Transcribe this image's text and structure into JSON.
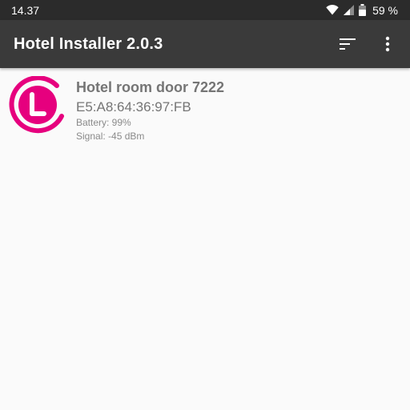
{
  "status_bar": {
    "time": "14.37",
    "battery": "59 %",
    "icons": [
      "wifi-icon",
      "cell-signal-icon",
      "battery-icon"
    ]
  },
  "app_bar": {
    "title": "Hotel Installer 2.0.3",
    "actions": [
      "sort-icon",
      "overflow-menu-icon"
    ]
  },
  "devices": [
    {
      "name": "Hotel room door 7222",
      "mac": "E5:A8:64:36:97:FB",
      "battery": "Battery: 99%",
      "signal": "Signal: -45 dBm",
      "icon": "lock-logo-icon"
    }
  ],
  "colors": {
    "status_bar": "#2b2b2b",
    "app_bar": "#3a3a3a",
    "background": "#fafafa",
    "brand_magenta": "#e6007e",
    "text_gray": "#757575"
  }
}
